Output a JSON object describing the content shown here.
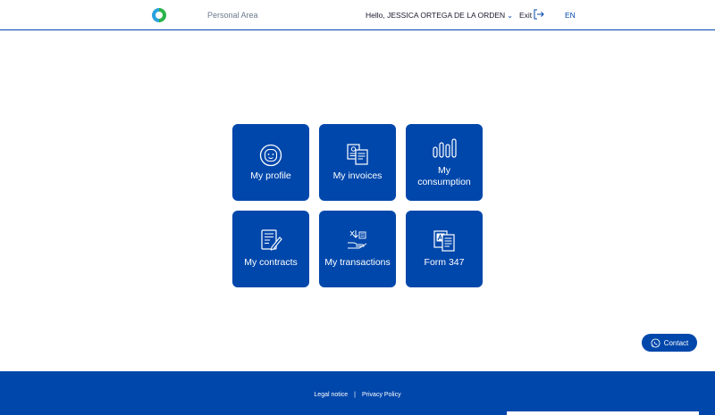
{
  "header": {
    "personal_area": "Personal Area",
    "greeting": "Hello, JESSICA ORTEGA DE LA ORDEN",
    "exit": "Exit",
    "lang": "EN"
  },
  "tiles": [
    {
      "label": "My profile",
      "icon": "face-icon"
    },
    {
      "label": "My invoices",
      "icon": "invoice-icon"
    },
    {
      "label_line1": "My",
      "label_line2": "consumption",
      "icon": "bar-chart-icon"
    },
    {
      "label": "My contracts",
      "icon": "contract-icon"
    },
    {
      "label": "My transactions",
      "icon": "transactions-icon"
    },
    {
      "label": "Form 347",
      "icon": "form-icon"
    }
  ],
  "contact": {
    "label": "Contact"
  },
  "footer": {
    "legal": "Legal notice",
    "privacy": "Privacy Policy"
  },
  "colors": {
    "primary": "#0047ab",
    "white": "#ffffff"
  }
}
